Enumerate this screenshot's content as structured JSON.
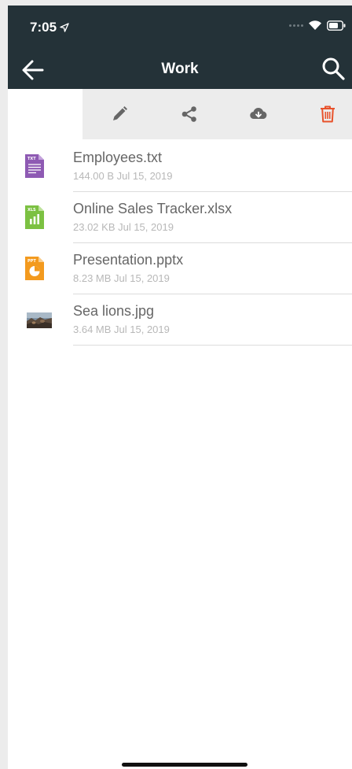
{
  "status": {
    "time": "7:05"
  },
  "nav": {
    "title": "Work"
  },
  "colors": {
    "bar": "#243238",
    "delete": "#e8522b",
    "tool": "#666666"
  },
  "toolbar": {
    "actions": [
      "pencil-icon",
      "share-icon",
      "cloud-download-icon",
      "trash-icon"
    ]
  },
  "files": [
    {
      "name": "Employees.txt",
      "info": "144.00 B Jul 15, 2019",
      "badge": "TXT",
      "icon": "txt-file-icon",
      "color": "#8e5ab3"
    },
    {
      "name": "Online Sales Tracker.xlsx",
      "info": "23.02 KB Jul 15, 2019",
      "badge": "XLS",
      "icon": "xlsx-file-icon",
      "color": "#7cc142"
    },
    {
      "name": "Presentation.pptx",
      "info": "8.23 MB Jul 15, 2019",
      "badge": "PPT",
      "icon": "pptx-file-icon",
      "color": "#f39a1e"
    },
    {
      "name": "Sea lions.jpg",
      "info": "3.64 MB Jul 15, 2019",
      "icon": "image-thumbnail-icon"
    }
  ]
}
